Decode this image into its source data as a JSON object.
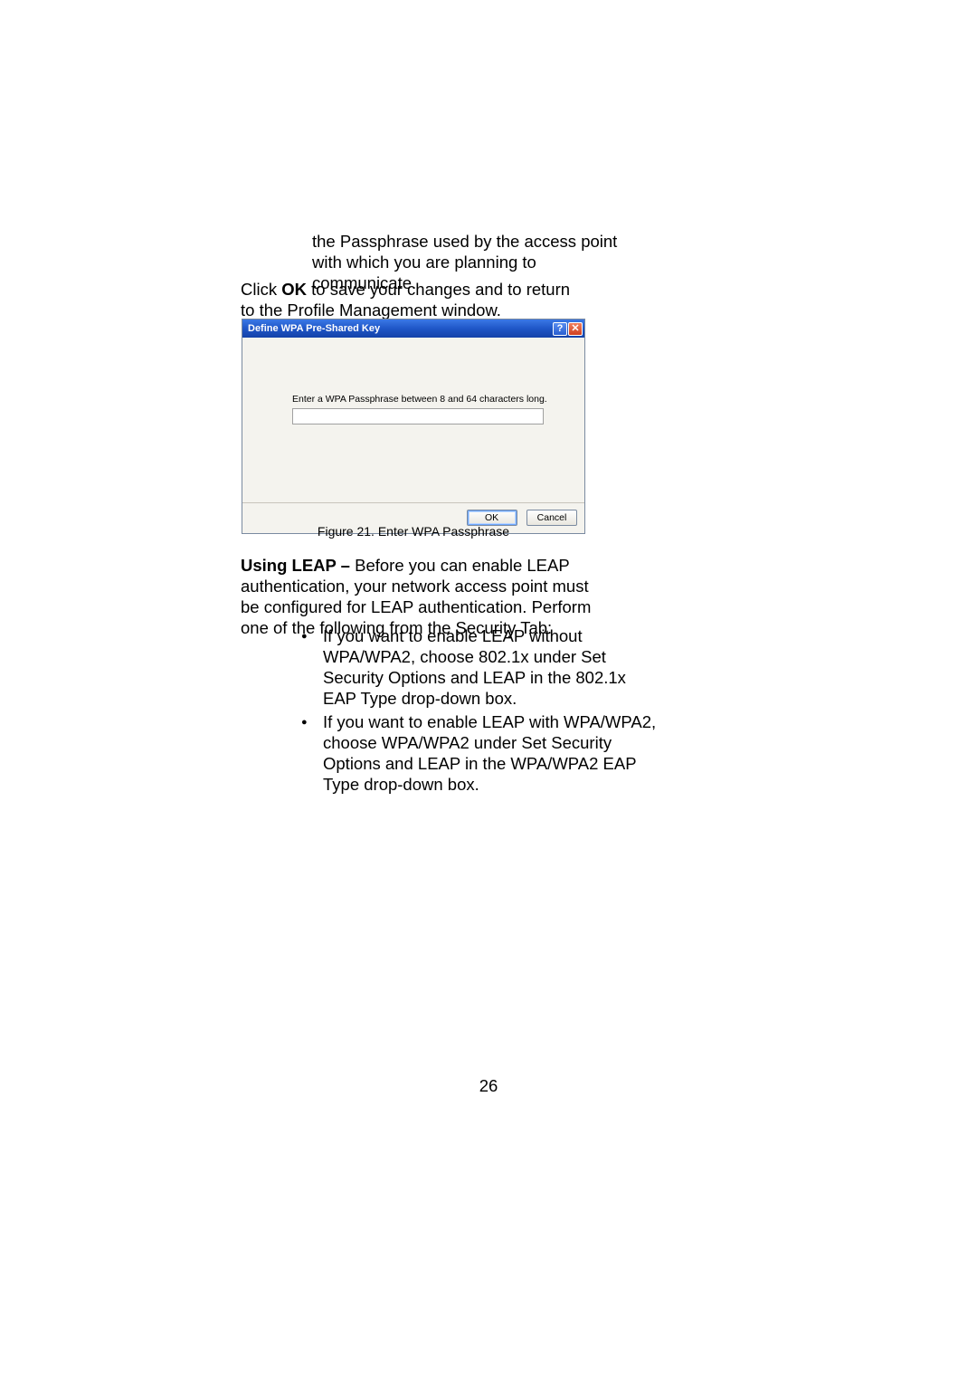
{
  "paragraphs": {
    "p1": "the Passphrase used by the access point with which you are planning to communicate.",
    "p2_pre": "Click ",
    "p2_bold": "OK",
    "p2_post": " to save your changes and to return to the Profile Management window.",
    "p3_bold": "Using LEAP – ",
    "p3_rest": "Before you can enable LEAP authentication, your network access point must be configured for LEAP authentication. Perform one of the following from the Security Tab:"
  },
  "dialog": {
    "title": "Define WPA Pre-Shared Key",
    "help_glyph": "?",
    "close_glyph": "✕",
    "instruction": "Enter a WPA Passphrase between 8 and 64 characters long.",
    "input_value": "",
    "ok_label": "OK",
    "cancel_label": "Cancel"
  },
  "caption": "Figure 21. Enter WPA Passphrase",
  "bullets": [
    "If you want to enable LEAP without WPA/WPA2, choose 802.1x under Set Security Options and LEAP in the 802.1x EAP Type drop-down box.",
    "If you want to enable LEAP with WPA/WPA2, choose WPA/WPA2 under Set Security Options and LEAP in the WPA/WPA2 EAP Type drop-down box."
  ],
  "page_number": "26"
}
